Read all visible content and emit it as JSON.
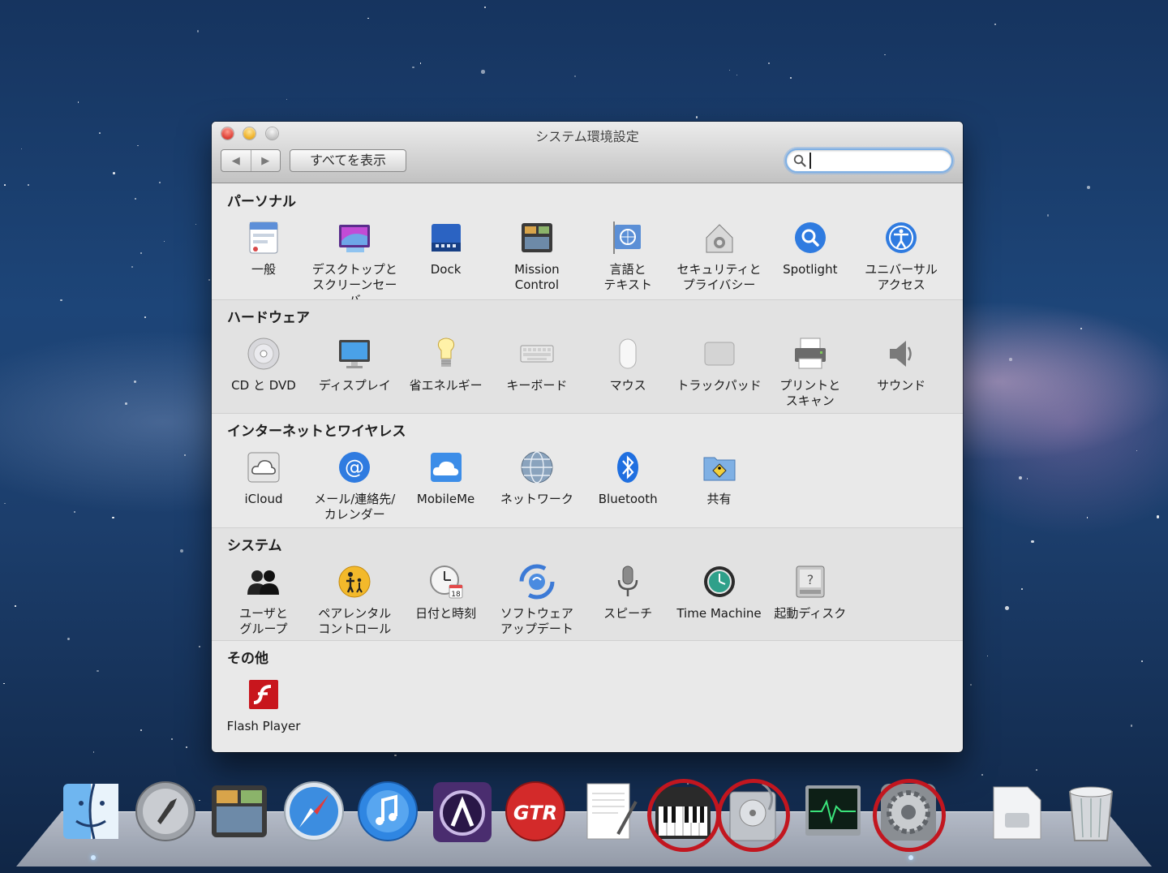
{
  "window": {
    "title": "システム環境設定",
    "show_all_label": "すべてを表示",
    "search_value": "",
    "back_glyph": "◀",
    "forward_glyph": "▶"
  },
  "sections": [
    {
      "title": "パーソナル",
      "items": [
        {
          "label": "一般",
          "icon": "general-icon"
        },
        {
          "label": "デスクトップと\nスクリーンセーバ",
          "icon": "desktop-screensaver-icon"
        },
        {
          "label": "Dock",
          "icon": "dock-icon"
        },
        {
          "label": "Mission\nControl",
          "icon": "mission-control-icon"
        },
        {
          "label": "言語と\nテキスト",
          "icon": "language-text-icon"
        },
        {
          "label": "セキュリティと\nプライバシー",
          "icon": "security-privacy-icon"
        },
        {
          "label": "Spotlight",
          "icon": "spotlight-icon"
        },
        {
          "label": "ユニバーサル\nアクセス",
          "icon": "universal-access-icon"
        }
      ]
    },
    {
      "title": "ハードウェア",
      "items": [
        {
          "label": "CD と DVD",
          "icon": "cd-dvd-icon"
        },
        {
          "label": "ディスプレイ",
          "icon": "display-icon"
        },
        {
          "label": "省エネルギー",
          "icon": "energy-saver-icon"
        },
        {
          "label": "キーボード",
          "icon": "keyboard-icon"
        },
        {
          "label": "マウス",
          "icon": "mouse-icon"
        },
        {
          "label": "トラックパッド",
          "icon": "trackpad-icon"
        },
        {
          "label": "プリントと\nスキャン",
          "icon": "print-scan-icon"
        },
        {
          "label": "サウンド",
          "icon": "sound-icon"
        }
      ]
    },
    {
      "title": "インターネットとワイヤレス",
      "items": [
        {
          "label": "iCloud",
          "icon": "icloud-icon"
        },
        {
          "label": "メール/連絡先/\nカレンダー",
          "icon": "mail-contacts-icon"
        },
        {
          "label": "MobileMe",
          "icon": "mobileme-icon"
        },
        {
          "label": "ネットワーク",
          "icon": "network-icon"
        },
        {
          "label": "Bluetooth",
          "icon": "bluetooth-icon"
        },
        {
          "label": "共有",
          "icon": "sharing-icon"
        }
      ]
    },
    {
      "title": "システム",
      "items": [
        {
          "label": "ユーザと\nグループ",
          "icon": "users-groups-icon"
        },
        {
          "label": "ペアレンタル\nコントロール",
          "icon": "parental-controls-icon"
        },
        {
          "label": "日付と時刻",
          "icon": "date-time-icon",
          "badge": "18"
        },
        {
          "label": "ソフトウェア\nアップデート",
          "icon": "software-update-icon"
        },
        {
          "label": "スピーチ",
          "icon": "speech-icon"
        },
        {
          "label": "Time Machine",
          "icon": "time-machine-icon"
        },
        {
          "label": "起動ディスク",
          "icon": "startup-disk-icon"
        }
      ]
    },
    {
      "title": "その他",
      "items": [
        {
          "label": "Flash Player",
          "icon": "flash-player-icon"
        }
      ]
    }
  ],
  "dock": {
    "items": [
      {
        "icon": "finder-icon"
      },
      {
        "icon": "launchpad-icon"
      },
      {
        "icon": "mission-control-dock-icon"
      },
      {
        "icon": "safari-icon"
      },
      {
        "icon": "itunes-icon"
      },
      {
        "icon": "pro-tools-icon"
      },
      {
        "icon": "guitar-rig-icon",
        "text": "GTR"
      },
      {
        "icon": "textedit-icon"
      },
      {
        "icon": "midi-keyboard-icon",
        "highlighted": true
      },
      {
        "icon": "disk-utility-icon",
        "highlighted": true
      },
      {
        "icon": "activity-monitor-icon"
      },
      {
        "icon": "system-preferences-icon",
        "highlighted": true
      },
      {
        "icon": "applications-folder-icon"
      },
      {
        "icon": "trash-icon"
      }
    ]
  },
  "colors": {
    "highlight_ring": "#c2161f",
    "search_focus": "#7fb0e4"
  }
}
